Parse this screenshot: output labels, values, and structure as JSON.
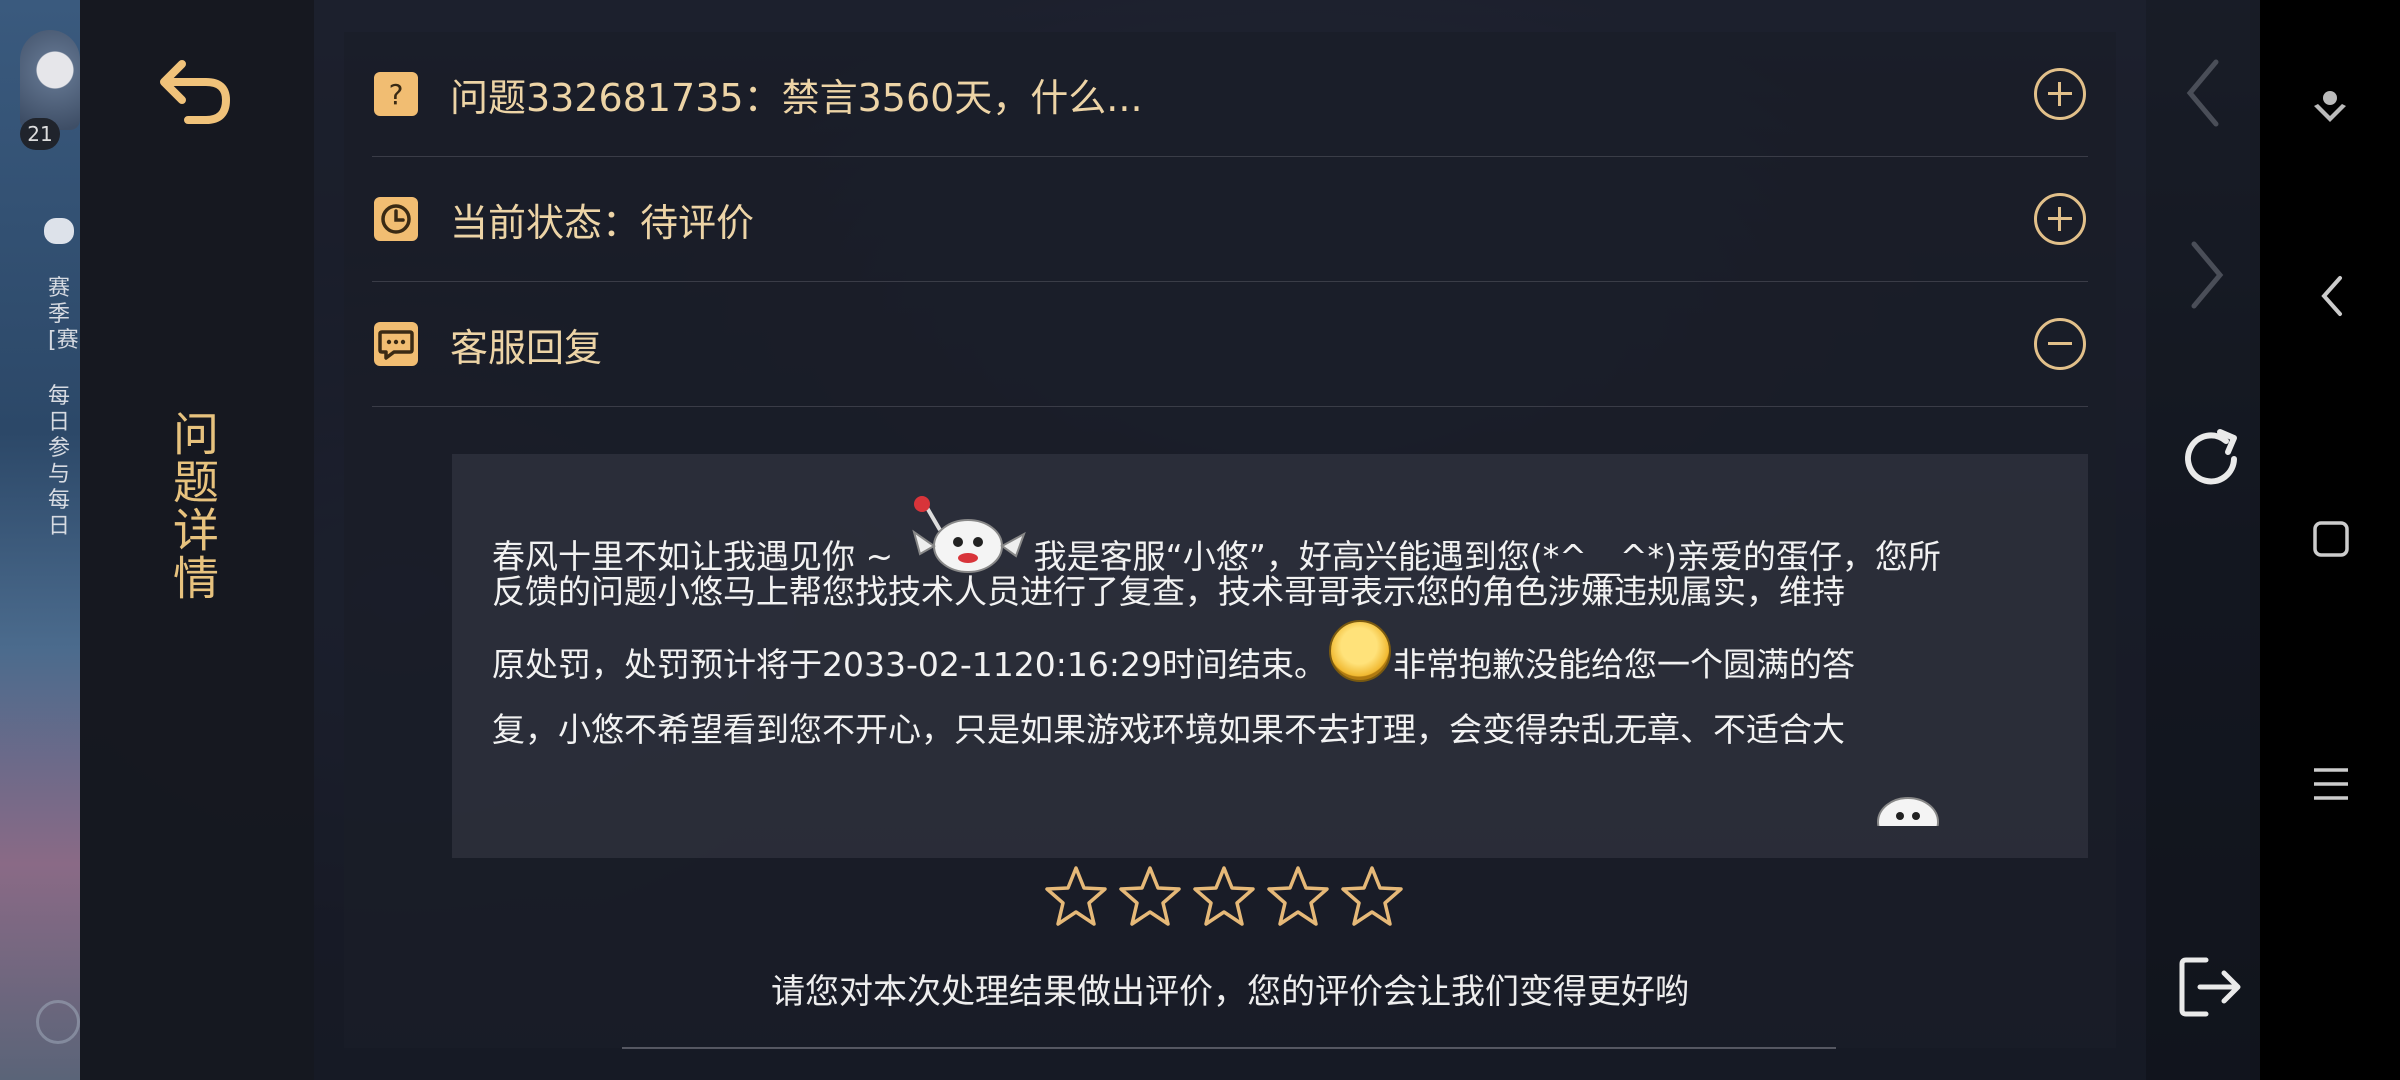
{
  "side_nav": {
    "title": "问题详情"
  },
  "rows": [
    {
      "label": "问题332681735：禁言3560天，什么...",
      "icon": "question-icon",
      "toggle": "expand"
    },
    {
      "label": "当前状态：待评价",
      "icon": "clock-icon",
      "toggle": "expand"
    },
    {
      "label": "客服回复",
      "icon": "chat-icon",
      "toggle": "collapse"
    }
  ],
  "reply": {
    "line1_a": "春风十里不如让我遇见你 ~ ",
    "line1_b": "我是客服“小悠”，好高兴能遇到您(*^__^*)亲爱的蛋仔，您所",
    "line2": "反馈的问题小悠马上帮您找技术人员进行了复查，技术哥哥表示您的角色涉嫌违规属实，维持",
    "line3_a": "原处罚，处罚预计将于2033-02-1120:16:29时间结束。",
    "line3_b": "非常抱歉没能给您一个圆满的答",
    "line4": "复，小悠不希望看到您不开心，只是如果游戏环境如果不去打理，会变得杂乱无章、不适合大"
  },
  "rating": {
    "stars_total": 5,
    "stars_selected": 0,
    "prompt": "请您对本次处理结果做出评价，您的评价会让我们变得更好哟"
  },
  "left_strip": {
    "badge": "21",
    "text1": "赛季[赛",
    "text2": "每日参与",
    "text3": "每日"
  },
  "colors": {
    "accent": "#e7c27e",
    "icon_bg": "#f1bd72",
    "text": "#edd4a6"
  }
}
